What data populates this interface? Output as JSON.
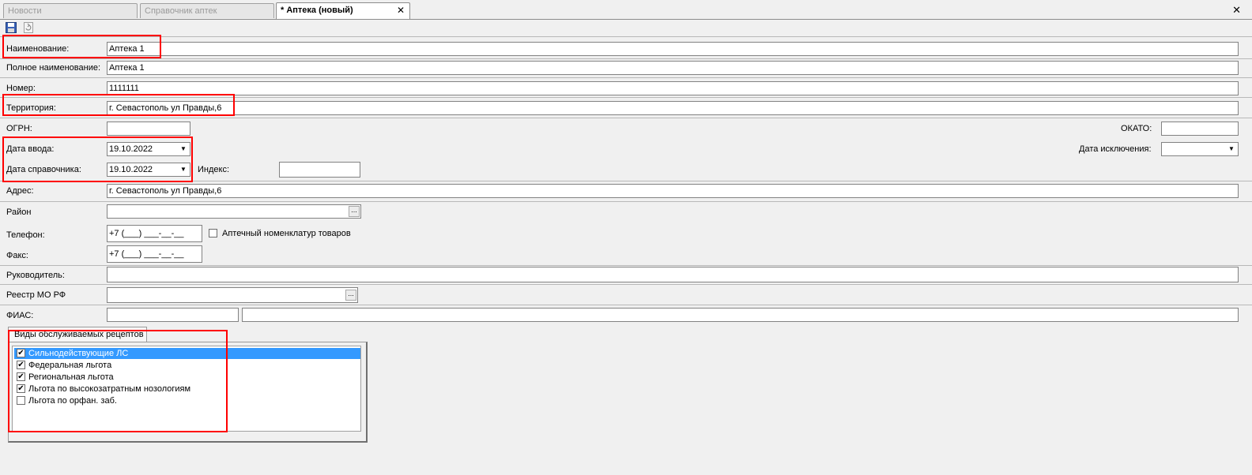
{
  "tabs": [
    {
      "label": "Новости"
    },
    {
      "label": "Справочник аптек"
    },
    {
      "label": "* Аптека (новый)",
      "close": "✕"
    }
  ],
  "closeall": "✕",
  "toolbar": {
    "save": "save-icon",
    "refresh": "refresh-icon"
  },
  "form": {
    "name": {
      "label": "Наименование:",
      "value": "Аптека 1"
    },
    "full_name": {
      "label": "Полное наименование:",
      "value": "Аптека 1"
    },
    "number": {
      "label": "Номер:",
      "value": "1111111"
    },
    "territory": {
      "label": "Территория:",
      "value": "г. Севастополь ул Правды,6"
    },
    "ogrn": {
      "label": "ОГРН:",
      "value": ""
    },
    "okato": {
      "label": "ОКАТО:",
      "value": ""
    },
    "entry_date": {
      "label": "Дата ввода:",
      "value": "19.10.2022"
    },
    "exclusion_date": {
      "label": "Дата исключения:",
      "value": ""
    },
    "ref_date": {
      "label": "Дата справочника:",
      "value": "19.10.2022"
    },
    "index": {
      "label": "Индекс:",
      "value": ""
    },
    "address": {
      "label": "Адрес:",
      "value": "г. Севастополь ул Правды,6"
    },
    "district": {
      "label": "Район",
      "value": "",
      "button": "..."
    },
    "phone": {
      "label": "Телефон:",
      "value": "+7 (___) ___-__-__"
    },
    "nomenclature": {
      "label": "Аптечный номенклатур товаров",
      "checked": false
    },
    "fax": {
      "label": "Факс:",
      "value": "+7 (___) ___-__-__"
    },
    "manager": {
      "label": "Руководитель:",
      "value": ""
    },
    "mo_registry": {
      "label": "Реестр МО РФ",
      "value": "",
      "button": "..."
    },
    "fias": {
      "label": "ФИАС:",
      "value1": "",
      "value2": ""
    }
  },
  "recipes": {
    "tab_label": "Виды обслуживаемых рецептов",
    "items": [
      {
        "label": "Сильнодействующие ЛС",
        "checked": true,
        "selected": true
      },
      {
        "label": "Федеральная льгота",
        "checked": true,
        "selected": false
      },
      {
        "label": "Региональная льгота",
        "checked": true,
        "selected": false
      },
      {
        "label": "Льгота по высокозатратным нозологиям",
        "checked": true,
        "selected": false
      },
      {
        "label": "Льгота по орфан. заб.",
        "checked": false,
        "selected": false
      }
    ]
  },
  "colors": {
    "highlight": "#ff0000",
    "selection": "#3399ff"
  }
}
